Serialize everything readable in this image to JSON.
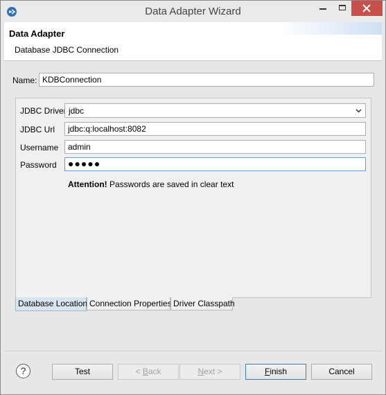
{
  "window": {
    "title": "Data Adapter Wizard"
  },
  "banner": {
    "title": "Data Adapter",
    "subtitle": "Database JDBC Connection"
  },
  "name_field": {
    "label": "Name:",
    "value": "KDBConnection"
  },
  "form": {
    "driver_label": "JDBC Driver",
    "driver_value": "jdbc",
    "url_label": "JDBC Url",
    "url_value": "jdbc:q:localhost:8082",
    "username_label": "Username",
    "username_value": "admin",
    "password_label": "Password",
    "password_value": "●●●●●",
    "attention_bold": "Attention!",
    "attention_text": " Passwords are saved in clear text"
  },
  "tabs": [
    {
      "label": "Database Location",
      "active": true
    },
    {
      "label": "Connection Properties",
      "active": false
    },
    {
      "label": "Driver Classpath",
      "active": false
    }
  ],
  "buttons": {
    "help": "?",
    "test": "Test",
    "back_prefix": "< ",
    "back_mnemonic": "B",
    "back_rest": "ack",
    "next_mnemonic": "N",
    "next_rest": "ext >",
    "finish_mnemonic": "F",
    "finish_rest": "inish",
    "cancel": "Cancel"
  },
  "colors": {
    "close_button": "#c7504d",
    "focus_border": "#569de5",
    "active_tab": "#d9e4f1"
  }
}
